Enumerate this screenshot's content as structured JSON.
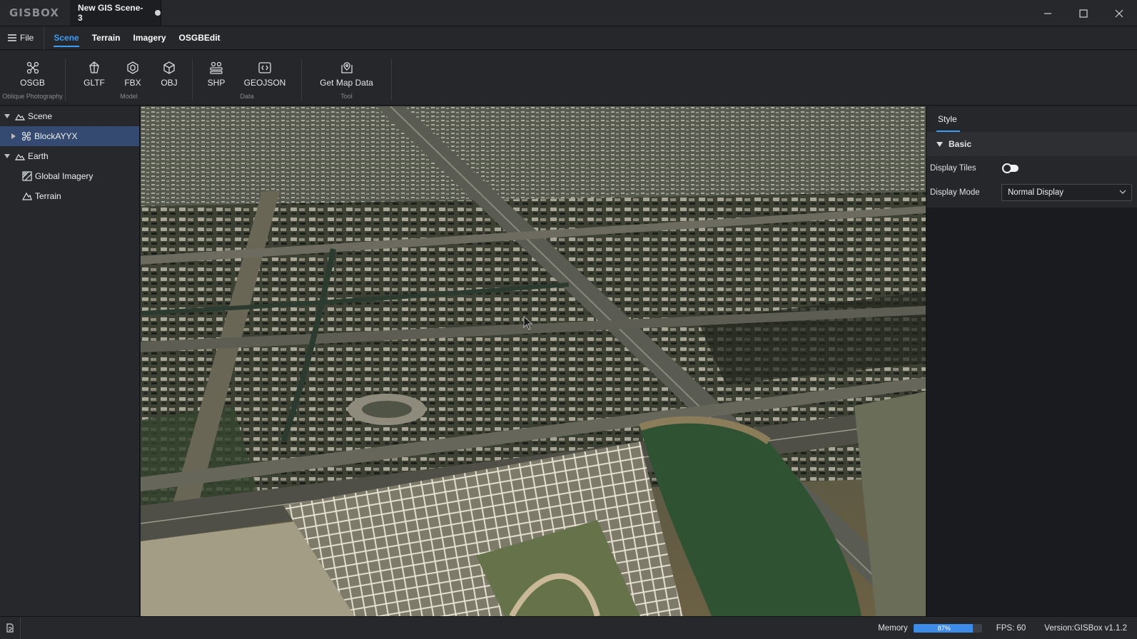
{
  "titlebar": {
    "logo": "GISBOX",
    "tab_title": "New GIS Scene-3",
    "icons": [
      "minimize-icon",
      "maximize-icon",
      "close-icon"
    ]
  },
  "menubar": {
    "file_label": "File",
    "tabs": [
      {
        "label": "Scene",
        "active": true
      },
      {
        "label": "Terrain",
        "active": false
      },
      {
        "label": "Imagery",
        "active": false
      },
      {
        "label": "OSGBEdit",
        "active": false
      }
    ]
  },
  "ribbon": {
    "groups": [
      {
        "label": "Oblique Photography",
        "tools": [
          {
            "label": "OSGB",
            "icon": "osgb-icon"
          }
        ]
      },
      {
        "label": "Model",
        "tools": [
          {
            "label": "GLTF",
            "icon": "gltf-icon"
          },
          {
            "label": "FBX",
            "icon": "fbx-icon"
          },
          {
            "label": "OBJ",
            "icon": "obj-icon"
          }
        ]
      },
      {
        "label": "Data",
        "tools": [
          {
            "label": "SHP",
            "icon": "shp-icon"
          },
          {
            "label": "GEOJSON",
            "icon": "geojson-icon"
          }
        ]
      },
      {
        "label": "Tool",
        "tools": [
          {
            "label": "Get Map Data",
            "icon": "map-pin-icon"
          }
        ]
      }
    ]
  },
  "tree": {
    "nodes": [
      {
        "label": "Scene",
        "level": 0,
        "expanded": true
      },
      {
        "label": "BlockAYYX",
        "level": 1,
        "selected": true
      },
      {
        "label": "Earth",
        "level": 0,
        "expanded": true
      },
      {
        "label": "Global Imagery",
        "level": 1
      },
      {
        "label": "Terrain",
        "level": 1
      }
    ]
  },
  "props": {
    "tab": "Style",
    "section": "Basic",
    "display_tiles_label": "Display Tiles",
    "display_tiles_on": false,
    "display_mode_label": "Display Mode",
    "display_mode_value": "Normal Display"
  },
  "status": {
    "memory_label": "Memory",
    "memory_percent": 87,
    "memory_text": "87%",
    "fps": "FPS: 60",
    "version": "Version:GISBox v1.1.2"
  },
  "colors": {
    "accent": "#3d9cf5",
    "selection": "#344a70",
    "memory_fill": "#3d8ce8"
  }
}
